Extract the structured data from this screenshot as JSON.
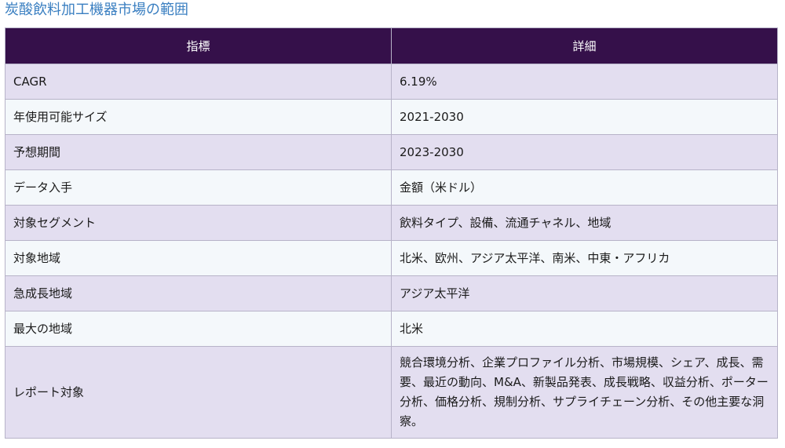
{
  "title": "炭酸飲料加工機器市場の範囲",
  "table": {
    "headers": [
      "指標",
      "詳細"
    ],
    "rows": [
      {
        "label": "CAGR",
        "value": "6.19%"
      },
      {
        "label": "年使用可能サイズ",
        "value": "2021-2030"
      },
      {
        "label": "予想期間",
        "value": "2023-2030"
      },
      {
        "label": "データ入手",
        "value": "金額（米ドル）"
      },
      {
        "label": "対象セグメント",
        "value": "飲料タイプ、設備、流通チャネル、地域"
      },
      {
        "label": "対象地域",
        "value": "北米、欧州、アジア太平洋、南米、中東・アフリカ"
      },
      {
        "label": "急成長地域",
        "value": "アジア太平洋"
      },
      {
        "label": "最大の地域",
        "value": "北米"
      },
      {
        "label": "レポート対象",
        "value": "競合環境分析、企業プロファイル分析、市場規模、シェア、成長、需要、最近の動向、M&A、新製品発表、成長戦略、収益分析、ポーター分析、価格分析、規制分析、サプライチェーン分析、その他主要な洞察。"
      }
    ]
  },
  "colors": {
    "title": "#3a7fc1",
    "header_bg": "#35104a",
    "row_odd": "#e3def0",
    "row_even": "#f4f8fb",
    "border": "#b7b3c8"
  }
}
